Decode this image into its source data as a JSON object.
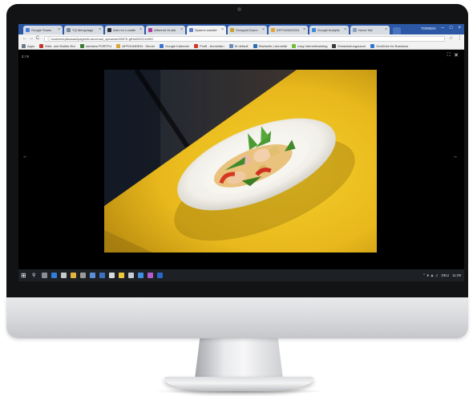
{
  "browser": {
    "tabs": [
      {
        "label": "Google Scans",
        "color": "#4a7bd6",
        "active": false
      },
      {
        "label": "YQ Mengvlags",
        "color": "#7a8aa0",
        "active": false
      },
      {
        "label": "Arbo en Locatie",
        "color": "#2a2f38",
        "active": false
      },
      {
        "label": "Afferend Grubb",
        "color": "#b03a9a",
        "active": false
      },
      {
        "label": "Spaeon subsite",
        "color": "#5d7fc9",
        "active": true
      },
      {
        "label": "Voorgold Duurz",
        "color": "#c8a234",
        "active": false
      },
      {
        "label": "AFFOUND2024",
        "color": "#e0a53a",
        "active": false
      },
      {
        "label": "Google Analytic",
        "color": "#3d8ad8",
        "active": false
      },
      {
        "label": "Nouw Tab",
        "color": "#8aa0c0",
        "active": false
      }
    ],
    "tab_close_glyph": "×",
    "profile_name": "TORBEN",
    "window_controls": {
      "minimize": "–",
      "maximize": "□",
      "close": "×"
    },
    "nav": {
      "back": "←",
      "forward": "→",
      "reload": "C",
      "secure": "ⓘ"
    },
    "url": "kustermeyllausasl/pages/fv.ancchaul_speanwe3JNFK-gfHsW2GCnWlO",
    "star": "☆",
    "menu": "⋮",
    "bookmarks": [
      {
        "label": "Apps",
        "color": "#6a7a8c"
      },
      {
        "label": "Web- und Mobile-Ent",
        "color": "#c0392b"
      },
      {
        "label": "domains PORTFU",
        "color": "#3b7c35"
      },
      {
        "label": "APFOUNDEM - Server",
        "color": "#d8a53a"
      },
      {
        "label": "Google Kalender",
        "color": "#3a74d0"
      },
      {
        "label": "Profil - Anmelden",
        "color": "#d0382b"
      },
      {
        "label": "W default",
        "color": "#6a8fba"
      },
      {
        "label": "Startseite | Anmelde",
        "color": "#2a6fb4"
      },
      {
        "label": "easy Internetbanking",
        "color": "#6fbf3a"
      },
      {
        "label": "Entwickelungsraum",
        "color": "#3a3a3a"
      },
      {
        "label": "OneDrive for Business",
        "color": "#2f77d1"
      }
    ]
  },
  "viewer": {
    "counter": "2 / 9",
    "fullscreen_glyph": "⛶",
    "close_glyph": "✕",
    "prev_glyph": "←",
    "next_glyph": "→"
  },
  "taskbar": {
    "start_glyph": "⊞",
    "search_glyph": "⚲",
    "pinned": [
      {
        "color": "#8a8f96"
      },
      {
        "color": "#2f7fd6"
      },
      {
        "color": "#c8c8c8"
      },
      {
        "color": "#e3b43a"
      },
      {
        "color": "#9a9a9a"
      },
      {
        "color": "#5b8fd9"
      },
      {
        "color": "#3c6fc0"
      },
      {
        "color": "#d7dbe0"
      },
      {
        "color": "#f0c93a"
      },
      {
        "color": "#c7ccd3"
      },
      {
        "color": "#3f8fe0"
      },
      {
        "color": "#b65ad0"
      },
      {
        "color": "#2a66c9"
      }
    ],
    "tray": {
      "icons": "⌃ ♦ ▲ ♫",
      "lang": "DEU",
      "time": "11:09"
    }
  }
}
